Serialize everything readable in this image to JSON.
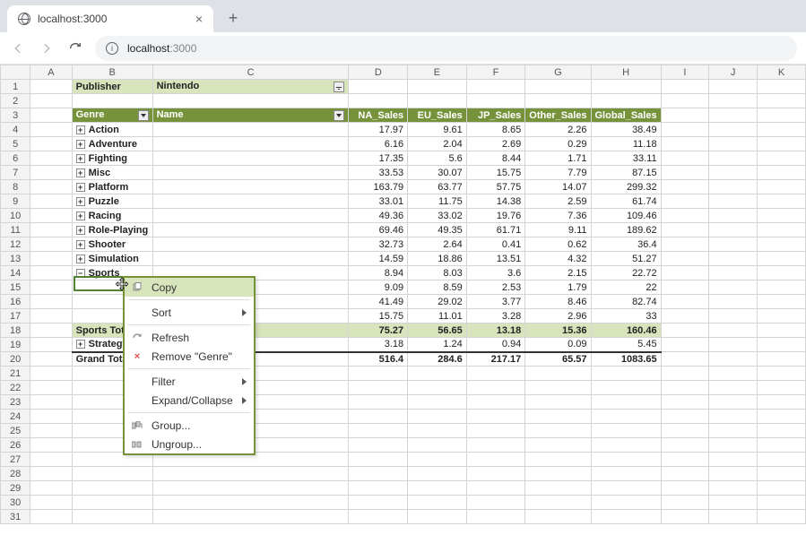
{
  "browser": {
    "tab_title": "localhost:3000",
    "url_host": "localhost",
    "url_path": ":3000"
  },
  "columns": [
    "A",
    "B",
    "C",
    "D",
    "E",
    "F",
    "G",
    "H",
    "I",
    "J",
    "K"
  ],
  "pivot": {
    "publisher_label": "Publisher",
    "publisher_value": "Nintendo",
    "row_field": "Genre",
    "col_field": "Name",
    "value_headers": [
      "NA_Sales",
      "EU_Sales",
      "JP_Sales",
      "Other_Sales",
      "Global_Sales"
    ],
    "rows": [
      {
        "label": "Action",
        "v": [
          17.97,
          9.61,
          8.65,
          2.26,
          38.49
        ]
      },
      {
        "label": "Adventure",
        "v": [
          6.16,
          2.04,
          2.69,
          0.29,
          11.18
        ]
      },
      {
        "label": "Fighting",
        "v": [
          17.35,
          5.6,
          8.44,
          1.71,
          33.11
        ]
      },
      {
        "label": "Misc",
        "v": [
          33.53,
          30.07,
          15.75,
          7.79,
          87.15
        ]
      },
      {
        "label": "Platform",
        "v": [
          163.79,
          63.77,
          57.75,
          14.07,
          299.32
        ]
      },
      {
        "label": "Puzzle",
        "v": [
          33.01,
          11.75,
          14.38,
          2.59,
          61.74
        ]
      },
      {
        "label": "Racing",
        "v": [
          49.36,
          33.02,
          19.76,
          7.36,
          109.46
        ]
      },
      {
        "label": "Role-Playing",
        "v": [
          69.46,
          49.35,
          61.71,
          9.11,
          189.62
        ]
      },
      {
        "label": "Shooter",
        "v": [
          32.73,
          2.64,
          0.41,
          0.62,
          36.4
        ]
      },
      {
        "label": "Simulation",
        "v": [
          14.59,
          18.86,
          13.51,
          4.32,
          51.27
        ]
      }
    ],
    "sports_expanded": {
      "label": "Sports",
      "detail_rows": [
        {
          "v": [
            8.94,
            8.03,
            3.6,
            2.15,
            22.72
          ]
        },
        {
          "v": [
            9.09,
            8.59,
            2.53,
            1.79,
            22
          ]
        },
        {
          "v": [
            41.49,
            29.02,
            3.77,
            8.46,
            82.74
          ]
        },
        {
          "v": [
            15.75,
            11.01,
            3.28,
            2.96,
            33
          ]
        }
      ],
      "subtotal_label": "Sports Total",
      "subtotal": [
        75.27,
        56.65,
        13.18,
        15.36,
        160.46
      ]
    },
    "strategy": {
      "label": "Strategy",
      "v": [
        3.18,
        1.24,
        0.94,
        0.09,
        5.45
      ]
    },
    "grand_label": "Grand Total",
    "grand": [
      516.4,
      284.6,
      217.17,
      65.57,
      1083.65
    ]
  },
  "context_menu": {
    "copy": "Copy",
    "sort": "Sort",
    "refresh": "Refresh",
    "remove": "Remove \"Genre\"",
    "filter": "Filter",
    "expand": "Expand/Collapse",
    "group": "Group...",
    "ungroup": "Ungroup..."
  }
}
